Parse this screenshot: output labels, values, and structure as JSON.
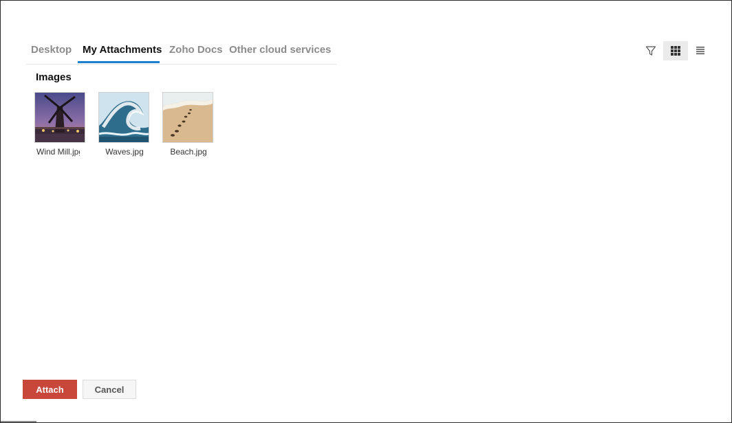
{
  "tabs": [
    {
      "label": "Desktop"
    },
    {
      "label": "My Attachments"
    },
    {
      "label": "Zoho Docs"
    },
    {
      "label": "Other cloud services"
    }
  ],
  "active_tab": "My Attachments",
  "toolbar": {
    "icons": [
      "filter-icon",
      "grid-view-icon",
      "list-view-icon"
    ],
    "active_view": "grid"
  },
  "section": {
    "title": "Images"
  },
  "files": [
    {
      "name": "Wind Mill.jpg"
    },
    {
      "name": "Waves.jpg"
    },
    {
      "name": "Beach.jpg"
    }
  ],
  "actions": {
    "attach_label": "Attach",
    "cancel_label": "Cancel"
  },
  "colors": {
    "accent": "#1a7fd0",
    "attach_button": "#c8473a"
  }
}
